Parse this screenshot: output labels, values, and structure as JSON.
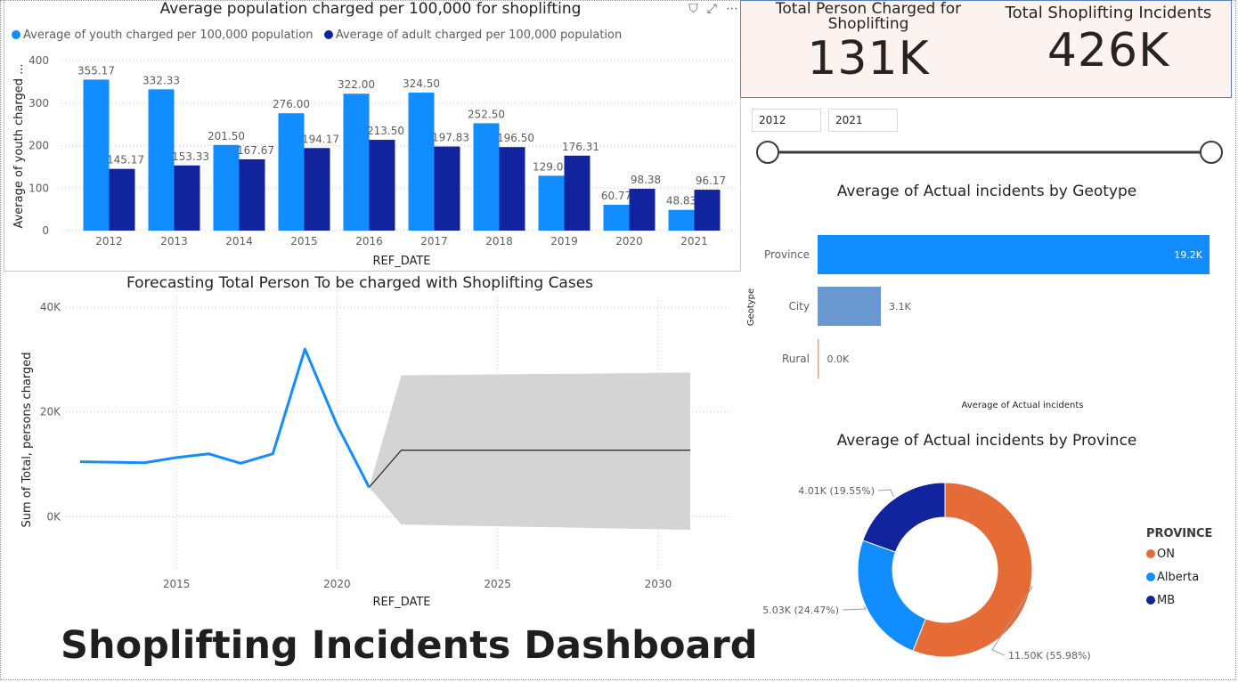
{
  "dashboard": {
    "title": "Shoplifting Incidents Dashboard"
  },
  "kpis": [
    {
      "label_line1": "Total Person Charged for",
      "label_line2": "Shoplifting",
      "value": "131K"
    },
    {
      "label_line1": "Total Shoplifting Incidents",
      "label_line2": "",
      "value": "426K"
    }
  ],
  "slicer": {
    "start": "2012",
    "end": "2021"
  },
  "header_icons": [
    "filter-icon",
    "focus-mode-icon",
    "more-options-icon"
  ],
  "colors": {
    "youth": "#118dff",
    "adult": "#12239e",
    "on": "#e66c37",
    "alberta": "#118dff",
    "mb": "#12239e",
    "city_bar": "#6b97d0",
    "rural_bar": "#e8a089",
    "forecast_band": "#d4d4d4"
  },
  "chart_data": [
    {
      "type": "bar",
      "title": "Average population charged per 100,000 for shoplifting",
      "xlabel": "REF_DATE",
      "ylabel": "Average of youth charged ...",
      "ylim": [
        0,
        400
      ],
      "yticks": [
        "0",
        "100",
        "200",
        "300",
        "400"
      ],
      "categories": [
        "2012",
        "2013",
        "2014",
        "2015",
        "2016",
        "2017",
        "2018",
        "2019",
        "2020",
        "2021"
      ],
      "series": [
        {
          "name": "Average of youth charged per 100,000 population",
          "values": [
            355.17,
            332.33,
            201.5,
            276.0,
            322.0,
            324.5,
            252.5,
            129.08,
            60.77,
            48.83
          ],
          "labels": [
            "355.17",
            "332.33",
            "201.50",
            "276.00",
            "322.00",
            "324.50",
            "252.50",
            "129.08",
            "60.77",
            "48.83"
          ]
        },
        {
          "name": "Average of adult charged per 100,000 population",
          "values": [
            145.17,
            153.33,
            167.67,
            194.17,
            213.5,
            197.83,
            196.5,
            176.31,
            98.38,
            96.17
          ],
          "labels": [
            "145.17",
            "153.33",
            "167.67",
            "194.17",
            "213.50",
            "197.83",
            "196.50",
            "176.31",
            "98.38",
            "96.17"
          ]
        }
      ],
      "grid": true,
      "legend": "top-left"
    },
    {
      "type": "line",
      "title": "Forecasting Total Person To be charged with Shoplifting Cases",
      "xlabel": "REF_DATE",
      "ylabel": "Sum of Total, persons charged",
      "xlim": [
        2012,
        2031
      ],
      "ylim": [
        -3000,
        40000
      ],
      "xticks": [
        "2015",
        "2020",
        "2025",
        "2030"
      ],
      "yticks": [
        {
          "v": 0,
          "label": "0K"
        },
        {
          "v": 20000,
          "label": "20K"
        },
        {
          "v": 40000,
          "label": "40K"
        }
      ],
      "actual": {
        "x": [
          2012,
          2013,
          2014,
          2015,
          2016,
          2017,
          2018,
          2019,
          2020,
          2021
        ],
        "y": [
          10500,
          10400,
          10300,
          11300,
          12000,
          10200,
          12000,
          32000,
          17500,
          5600
        ]
      },
      "forecast": {
        "x": [
          2021,
          2022,
          2031
        ],
        "y": [
          5600,
          12700,
          12700
        ]
      },
      "forecast_upper": {
        "x": [
          2021,
          2022,
          2031
        ],
        "y": [
          5600,
          27000,
          27500
        ]
      },
      "forecast_lower": {
        "x": [
          2021,
          2022,
          2031
        ],
        "y": [
          5600,
          -1500,
          -2500
        ]
      },
      "grid": true
    },
    {
      "type": "bar",
      "orientation": "horizontal",
      "title": "Average of Actual incidents by Geotype",
      "xlabel": "Average of Actual incidents",
      "ylabel": "Geotype",
      "categories": [
        "Province",
        "City",
        "Rural"
      ],
      "values": [
        19.2,
        3.1,
        0.0
      ],
      "labels": [
        "19.2K",
        "3.1K",
        "0.0K"
      ],
      "xlim": [
        0,
        19.2
      ]
    },
    {
      "type": "pie",
      "donut": true,
      "title": "Average of Actual incidents by Province",
      "legend_title": "PROVINCE",
      "categories": [
        "ON",
        "Alberta",
        "MB"
      ],
      "values": [
        11.5,
        5.03,
        4.01
      ],
      "labels": [
        "11.50K (55.98%)",
        "5.03K (24.47%)",
        "4.01K (19.55%)"
      ],
      "legend": "right"
    }
  ]
}
